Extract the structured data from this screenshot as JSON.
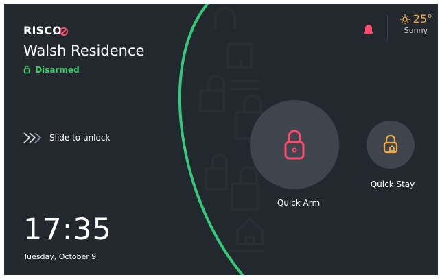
{
  "brand": {
    "name": "RISCO"
  },
  "home": {
    "residence": "Walsh Residence",
    "status": "Disarmed"
  },
  "unlock": {
    "label": "Slide to unlock"
  },
  "time": {
    "clock": "17:35",
    "date": "Tuesday, October 9"
  },
  "weather": {
    "temperature": "25°",
    "condition": "Sunny"
  },
  "actions": {
    "quick_arm": "Quick Arm",
    "quick_stay": "Quick Stay"
  },
  "colors": {
    "background": "#23272e",
    "accent_green": "#3ecb6a",
    "arm_red": "#ff4b6e",
    "stay_orange": "#f0ad3c"
  },
  "icons": {
    "status": "unlock-icon",
    "unlock": "double-chevron-icon",
    "arm": "lock-icon",
    "stay": "stay-lock-icon",
    "siren": "siren-icon",
    "weather": "sun-icon"
  }
}
